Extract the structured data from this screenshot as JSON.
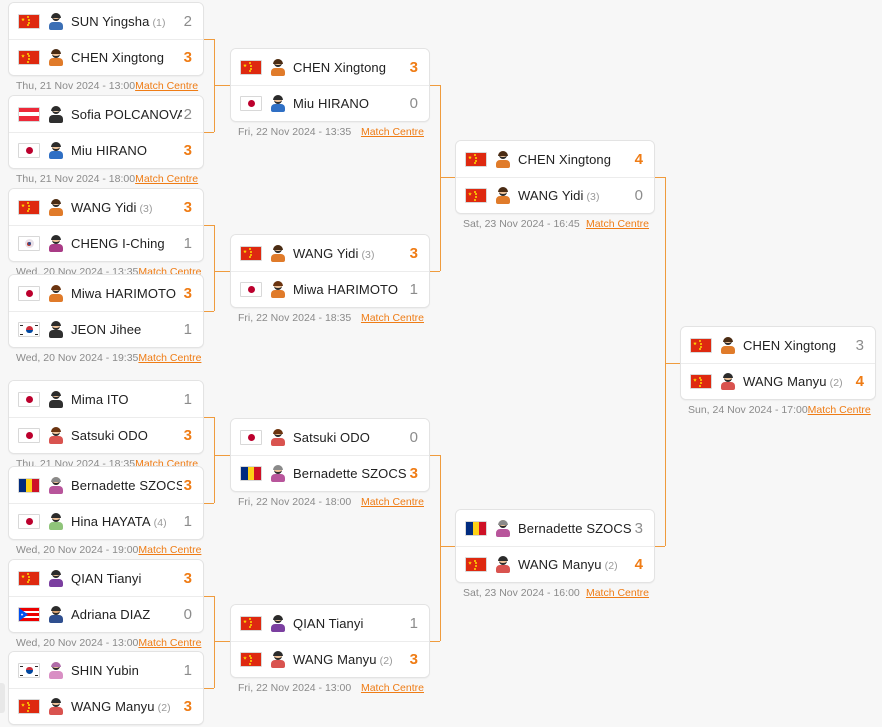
{
  "labels": {
    "match_centre": "Match Centre"
  },
  "colors": {
    "accent": "#ef7c15",
    "connector": "#ef9b3d",
    "score_loser": "#8c8c8c",
    "background": "#f7f7f7",
    "card": "#ffffff"
  },
  "rounds": [
    {
      "name": "round-of-16",
      "matches": [
        {
          "id": "r16-m1",
          "date": "Thu, 21 Nov 2024 - 13:00",
          "players": [
            {
              "name": "SUN Yingsha",
              "seed": "(1)",
              "score": "2",
              "winner": false,
              "flag": "china",
              "skin": "#f0c49b",
              "hair": "#2b2b2b",
              "shirt": "#3b6fb5"
            },
            {
              "name": "CHEN Xingtong",
              "seed": "",
              "score": "3",
              "winner": true,
              "flag": "china",
              "skin": "#f0c49b",
              "hair": "#4a2c14",
              "shirt": "#e07b2a"
            }
          ]
        },
        {
          "id": "r16-m2",
          "date": "Thu, 21 Nov 2024 - 18:00",
          "players": [
            {
              "name": "Sofia POLCANOVA",
              "seed": "",
              "score": "2",
              "winner": false,
              "flag": "austria",
              "skin": "#f2d3b4",
              "hair": "#2b2b2b",
              "shirt": "#2f2f2f"
            },
            {
              "name": "Miu HIRANO",
              "seed": "",
              "score": "3",
              "winner": true,
              "flag": "japan",
              "skin": "#f0c49b",
              "hair": "#2b2b2b",
              "shirt": "#2f6fc4"
            }
          ]
        },
        {
          "id": "r16-m3",
          "date": "Wed, 20 Nov 2024 - 13:35",
          "players": [
            {
              "name": "WANG Yidi",
              "seed": "(3)",
              "score": "3",
              "winner": true,
              "flag": "china",
              "skin": "#f0c49b",
              "hair": "#4a2c14",
              "shirt": "#e07b2a"
            },
            {
              "name": "CHENG I-Ching",
              "seed": "",
              "score": "1",
              "winner": false,
              "flag": "chinese-taipei",
              "skin": "#f0c49b",
              "hair": "#2b2b2b",
              "shirt": "#a93b86"
            }
          ]
        },
        {
          "id": "r16-m4",
          "date": "Wed, 20 Nov 2024 - 19:35",
          "players": [
            {
              "name": "Miwa HARIMOTO",
              "seed": "",
              "score": "3",
              "winner": true,
              "flag": "japan",
              "skin": "#f0c49b",
              "hair": "#6b3410",
              "shirt": "#e07b2a"
            },
            {
              "name": "JEON Jihee",
              "seed": "",
              "score": "1",
              "winner": false,
              "flag": "korea",
              "skin": "#f0c49b",
              "hair": "#2b2b2b",
              "shirt": "#2f2f2f"
            }
          ]
        },
        {
          "id": "r16-m5",
          "date": "Thu, 21 Nov 2024 - 18:35",
          "players": [
            {
              "name": "Mima ITO",
              "seed": "",
              "score": "1",
              "winner": false,
              "flag": "japan",
              "skin": "#f0c49b",
              "hair": "#2b2b2b",
              "shirt": "#2f2f2f"
            },
            {
              "name": "Satsuki ODO",
              "seed": "",
              "score": "3",
              "winner": true,
              "flag": "japan",
              "skin": "#f0c49b",
              "hair": "#6b3410",
              "shirt": "#d9534f"
            }
          ]
        },
        {
          "id": "r16-m6",
          "date": "Wed, 20 Nov 2024 - 19:00",
          "players": [
            {
              "name": "Bernadette SZOCS",
              "seed": "",
              "score": "3",
              "winner": true,
              "flag": "romania",
              "skin": "#f0c49b",
              "hair": "#8a8a8a",
              "shirt": "#b8559b"
            },
            {
              "name": "Hina HAYATA",
              "seed": "(4)",
              "score": "1",
              "winner": false,
              "flag": "japan",
              "skin": "#f0c49b",
              "hair": "#2b2b2b",
              "shirt": "#8fc47a"
            }
          ]
        },
        {
          "id": "r16-m7",
          "date": "Wed, 20 Nov 2024 - 13:00",
          "players": [
            {
              "name": "QIAN Tianyi",
              "seed": "",
              "score": "3",
              "winner": true,
              "flag": "china",
              "skin": "#f0c49b",
              "hair": "#2b2b2b",
              "shirt": "#7b3fa0"
            },
            {
              "name": "Adriana DIAZ",
              "seed": "",
              "score": "0",
              "winner": false,
              "flag": "puerto-rico",
              "skin": "#d8a273",
              "hair": "#2b2b2b",
              "shirt": "#2f4f8f"
            }
          ]
        },
        {
          "id": "r16-m8",
          "date": null,
          "players": [
            {
              "name": "SHIN Yubin",
              "seed": "",
              "score": "1",
              "winner": false,
              "flag": "korea",
              "skin": "#f0c49b",
              "hair": "#b06ba8",
              "shirt": "#d98fc4"
            },
            {
              "name": "WANG Manyu",
              "seed": "(2)",
              "score": "3",
              "winner": true,
              "flag": "china",
              "skin": "#f0c49b",
              "hair": "#2b2b2b",
              "shirt": "#d9534f"
            }
          ]
        }
      ]
    },
    {
      "name": "quarter-finals",
      "matches": [
        {
          "id": "qf-m1",
          "date": "Fri, 22 Nov 2024 - 13:35",
          "players": [
            {
              "name": "CHEN Xingtong",
              "seed": "",
              "score": "3",
              "winner": true,
              "flag": "china",
              "skin": "#f0c49b",
              "hair": "#4a2c14",
              "shirt": "#e07b2a"
            },
            {
              "name": "Miu HIRANO",
              "seed": "",
              "score": "0",
              "winner": false,
              "flag": "japan",
              "skin": "#f0c49b",
              "hair": "#2b2b2b",
              "shirt": "#2f6fc4"
            }
          ]
        },
        {
          "id": "qf-m2",
          "date": "Fri, 22 Nov 2024 - 18:35",
          "players": [
            {
              "name": "WANG Yidi",
              "seed": "(3)",
              "score": "3",
              "winner": true,
              "flag": "china",
              "skin": "#f0c49b",
              "hair": "#4a2c14",
              "shirt": "#e07b2a"
            },
            {
              "name": "Miwa HARIMOTO",
              "seed": "",
              "score": "1",
              "winner": false,
              "flag": "japan",
              "skin": "#f0c49b",
              "hair": "#6b3410",
              "shirt": "#e07b2a"
            }
          ]
        },
        {
          "id": "qf-m3",
          "date": "Fri, 22 Nov 2024 - 18:00",
          "players": [
            {
              "name": "Satsuki ODO",
              "seed": "",
              "score": "0",
              "winner": false,
              "flag": "japan",
              "skin": "#f0c49b",
              "hair": "#6b3410",
              "shirt": "#d9534f"
            },
            {
              "name": "Bernadette SZOCS",
              "seed": "",
              "score": "3",
              "winner": true,
              "flag": "romania",
              "skin": "#f0c49b",
              "hair": "#8a8a8a",
              "shirt": "#b8559b"
            }
          ]
        },
        {
          "id": "qf-m4",
          "date": "Fri, 22 Nov 2024 - 13:00",
          "players": [
            {
              "name": "QIAN Tianyi",
              "seed": "",
              "score": "1",
              "winner": false,
              "flag": "china",
              "skin": "#f0c49b",
              "hair": "#2b2b2b",
              "shirt": "#7b3fa0"
            },
            {
              "name": "WANG Manyu",
              "seed": "(2)",
              "score": "3",
              "winner": true,
              "flag": "china",
              "skin": "#f0c49b",
              "hair": "#2b2b2b",
              "shirt": "#d9534f"
            }
          ]
        }
      ]
    },
    {
      "name": "semi-finals",
      "matches": [
        {
          "id": "sf-m1",
          "date": "Sat, 23 Nov 2024 - 16:45",
          "players": [
            {
              "name": "CHEN Xingtong",
              "seed": "",
              "score": "4",
              "winner": true,
              "flag": "china",
              "skin": "#f0c49b",
              "hair": "#4a2c14",
              "shirt": "#e07b2a"
            },
            {
              "name": "WANG Yidi",
              "seed": "(3)",
              "score": "0",
              "winner": false,
              "flag": "china",
              "skin": "#f0c49b",
              "hair": "#4a2c14",
              "shirt": "#e07b2a"
            }
          ]
        },
        {
          "id": "sf-m2",
          "date": "Sat, 23 Nov 2024 - 16:00",
          "players": [
            {
              "name": "Bernadette SZOCS",
              "seed": "",
              "score": "3",
              "winner": false,
              "flag": "romania",
              "skin": "#f0c49b",
              "hair": "#8a8a8a",
              "shirt": "#b8559b"
            },
            {
              "name": "WANG Manyu",
              "seed": "(2)",
              "score": "4",
              "winner": true,
              "flag": "china",
              "skin": "#f0c49b",
              "hair": "#2b2b2b",
              "shirt": "#d9534f"
            }
          ]
        }
      ]
    },
    {
      "name": "final",
      "matches": [
        {
          "id": "f-m1",
          "date": "Sun, 24 Nov 2024 - 17:00",
          "players": [
            {
              "name": "CHEN Xingtong",
              "seed": "",
              "score": "3",
              "winner": false,
              "flag": "china",
              "skin": "#f0c49b",
              "hair": "#4a2c14",
              "shirt": "#e07b2a"
            },
            {
              "name": "WANG Manyu",
              "seed": "(2)",
              "score": "4",
              "winner": true,
              "flag": "china",
              "skin": "#f0c49b",
              "hair": "#2b2b2b",
              "shirt": "#d9534f"
            }
          ]
        }
      ]
    }
  ]
}
